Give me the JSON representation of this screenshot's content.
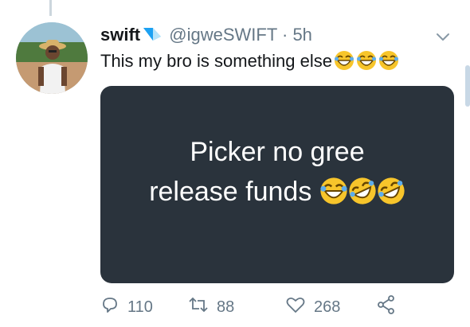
{
  "tweet": {
    "author_name": "swift",
    "handle": "@igweSWIFT",
    "separator": "·",
    "time": "5h",
    "text": "This my bro is something else",
    "text_emoji_count": 3,
    "media": {
      "line1": "Picker no gree",
      "line2": "release funds"
    }
  },
  "actions": {
    "replies": "110",
    "retweets": "88",
    "likes": "268"
  },
  "icons": {
    "verified": "verified-badge-icon",
    "more": "chevron-down-icon",
    "reply": "reply-icon",
    "retweet": "retweet-icon",
    "like": "heart-icon",
    "share": "share-icon"
  },
  "colors": {
    "text": "#14171a",
    "secondary": "#657786",
    "media_bg": "#2a333c",
    "verified": "#1da1f2"
  }
}
